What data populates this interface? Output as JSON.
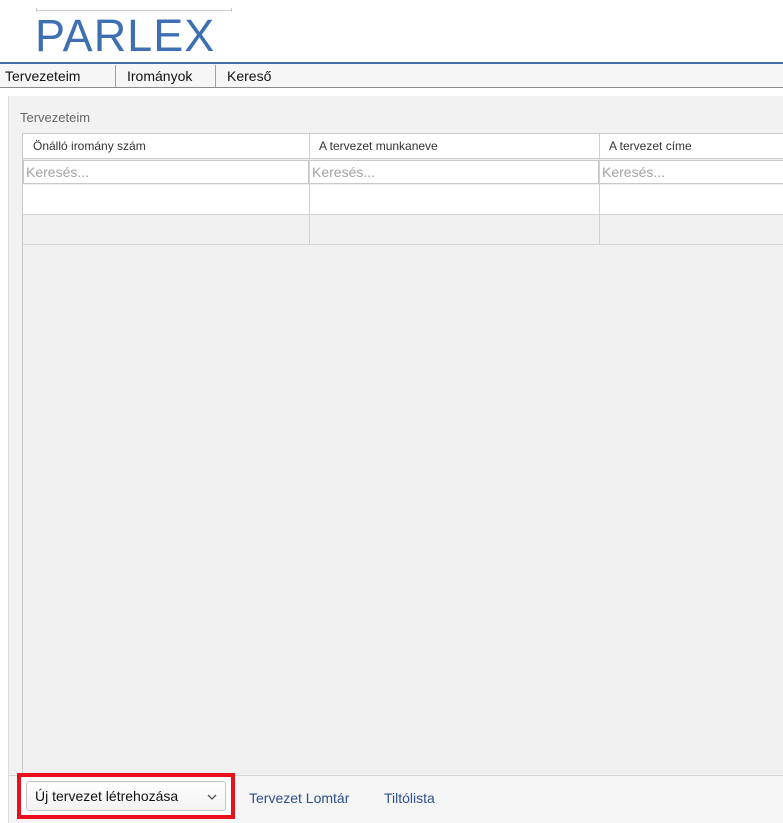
{
  "app": {
    "logo_text": "PARLEX"
  },
  "menu": {
    "items": [
      "Tervezeteim",
      "Irományok",
      "Kereső"
    ]
  },
  "panel": {
    "title": "Tervezeteim"
  },
  "grid": {
    "columns": [
      "Önálló iromány szám",
      "A tervezet munkaneve",
      "A tervezet címe"
    ],
    "filter_placeholder": "Keresés..."
  },
  "footer": {
    "new_button_label": "Új tervezet létrehozása",
    "links": [
      "Tervezet Lomtár",
      "Tiltólista"
    ]
  },
  "colors": {
    "accent": "#3f6fb3",
    "highlight_border": "#e8111b",
    "link": "#2d4f8e"
  },
  "icons": {
    "dropdown": "chevron-down-icon"
  }
}
